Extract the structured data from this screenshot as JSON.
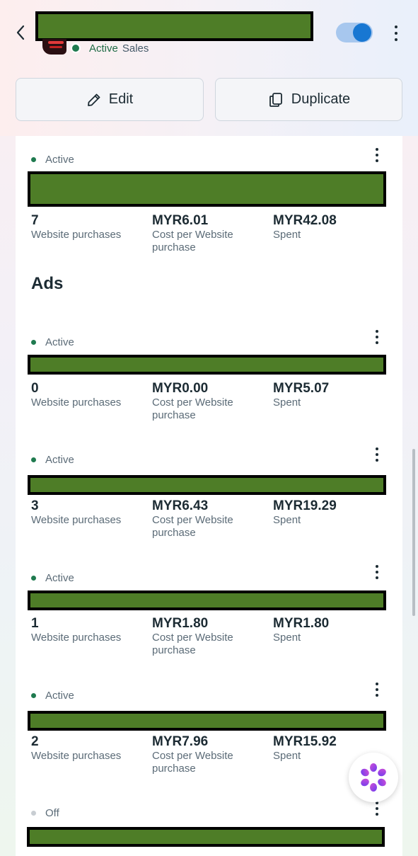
{
  "header": {
    "status": "Active",
    "objective": "Sales",
    "toggle_on": true,
    "edit_label": "Edit",
    "duplicate_label": "Duplicate"
  },
  "ad_set": {
    "status": "Active",
    "purchases": "7",
    "purchases_label": "Website purchases",
    "cost": "MYR6.01",
    "cost_label_1": "Cost per Website",
    "cost_label_2": "purchase",
    "spent": "MYR42.08",
    "spent_label": "Spent"
  },
  "ads_title": "Ads",
  "ads": [
    {
      "status": "Active",
      "purchases": "0",
      "purchases_label": "Website purchases",
      "cost": "MYR0.00",
      "cost_label_1": "Cost per Website",
      "cost_label_2": "purchase",
      "spent": "MYR5.07",
      "spent_label": "Spent"
    },
    {
      "status": "Active",
      "purchases": "3",
      "purchases_label": "Website purchases",
      "cost": "MYR6.43",
      "cost_label_1": "Cost per Website",
      "cost_label_2": "purchase",
      "spent": "MYR19.29",
      "spent_label": "Spent"
    },
    {
      "status": "Active",
      "purchases": "1",
      "purchases_label": "Website purchases",
      "cost": "MYR1.80",
      "cost_label_1": "Cost per Website",
      "cost_label_2": "purchase",
      "spent": "MYR1.80",
      "spent_label": "Spent"
    },
    {
      "status": "Active",
      "purchases": "2",
      "purchases_label": "Website purchases",
      "cost": "MYR7.96",
      "cost_label_1": "Cost per Website",
      "cost_label_2": "purchase",
      "spent": "MYR15.92",
      "spent_label": "Spent"
    },
    {
      "status": "Off"
    }
  ],
  "colors": {
    "active_green": "#1f7a4f",
    "toggle_blue": "#1877d2",
    "redaction_green": "#4e7d27"
  },
  "icons": [
    "back-arrow-icon",
    "more-options-icon",
    "pencil-icon",
    "duplicate-icon",
    "meta-ai-icon"
  ]
}
